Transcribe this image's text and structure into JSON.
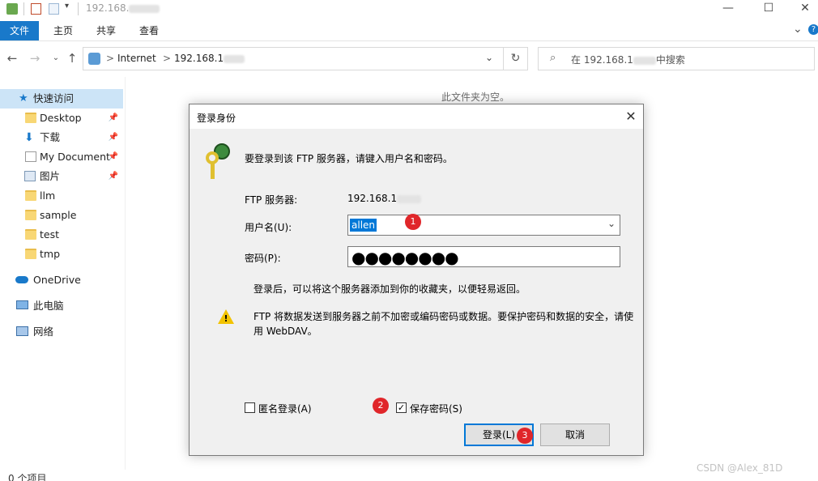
{
  "window": {
    "title": "192.168.",
    "minimize": "—",
    "maximize": "☐",
    "close": "✕"
  },
  "ribbon": {
    "file": "文件",
    "home": "主页",
    "share": "共享",
    "view": "查看",
    "collapse": "⌄",
    "help": "?"
  },
  "address": {
    "root": "Internet",
    "ip": "192.168.1",
    "separator": ">"
  },
  "search": {
    "placeholder": "在 192.168.1",
    "suffix": "中搜索"
  },
  "sidebar": {
    "items": [
      {
        "label": "快速访问"
      },
      {
        "label": "Desktop"
      },
      {
        "label": "下载"
      },
      {
        "label": "My Document"
      },
      {
        "label": "图片"
      },
      {
        "label": "llm"
      },
      {
        "label": "sample"
      },
      {
        "label": "test"
      },
      {
        "label": "tmp"
      },
      {
        "label": "OneDrive"
      },
      {
        "label": "此电脑"
      },
      {
        "label": "网络"
      }
    ]
  },
  "content": {
    "empty_message": "此文件夹为空。"
  },
  "status": {
    "item_count": "0 个项目"
  },
  "watermark": "CSDN @Alex_81D",
  "dialog": {
    "title": "登录身份",
    "intro": "要登录到该 FTP 服务器，请键入用户名和密码。",
    "server_label": "FTP 服务器:",
    "server_value": "192.168.1",
    "username_label": "用户名(U):",
    "username_value": "allen",
    "password_label": "密码(P):",
    "password_value": "●●●●●●●●",
    "info": "登录后，可以将这个服务器添加到你的收藏夹，以便轻易返回。",
    "warning_line1": "FTP 将数据发送到服务器之前不加密或编码密码或数据。要保护密码和数据的安全，请使",
    "warning_line2": "用 WebDAV。",
    "anonymous_label": "匿名登录(A)",
    "save_password_label": "保存密码(S)",
    "login_button": "登录(L)",
    "cancel_button": "取消",
    "badges": [
      "1",
      "2",
      "3"
    ]
  },
  "colors": {
    "accent": "#1979ca",
    "badge": "#e0262a",
    "selection": "#0078d7"
  }
}
